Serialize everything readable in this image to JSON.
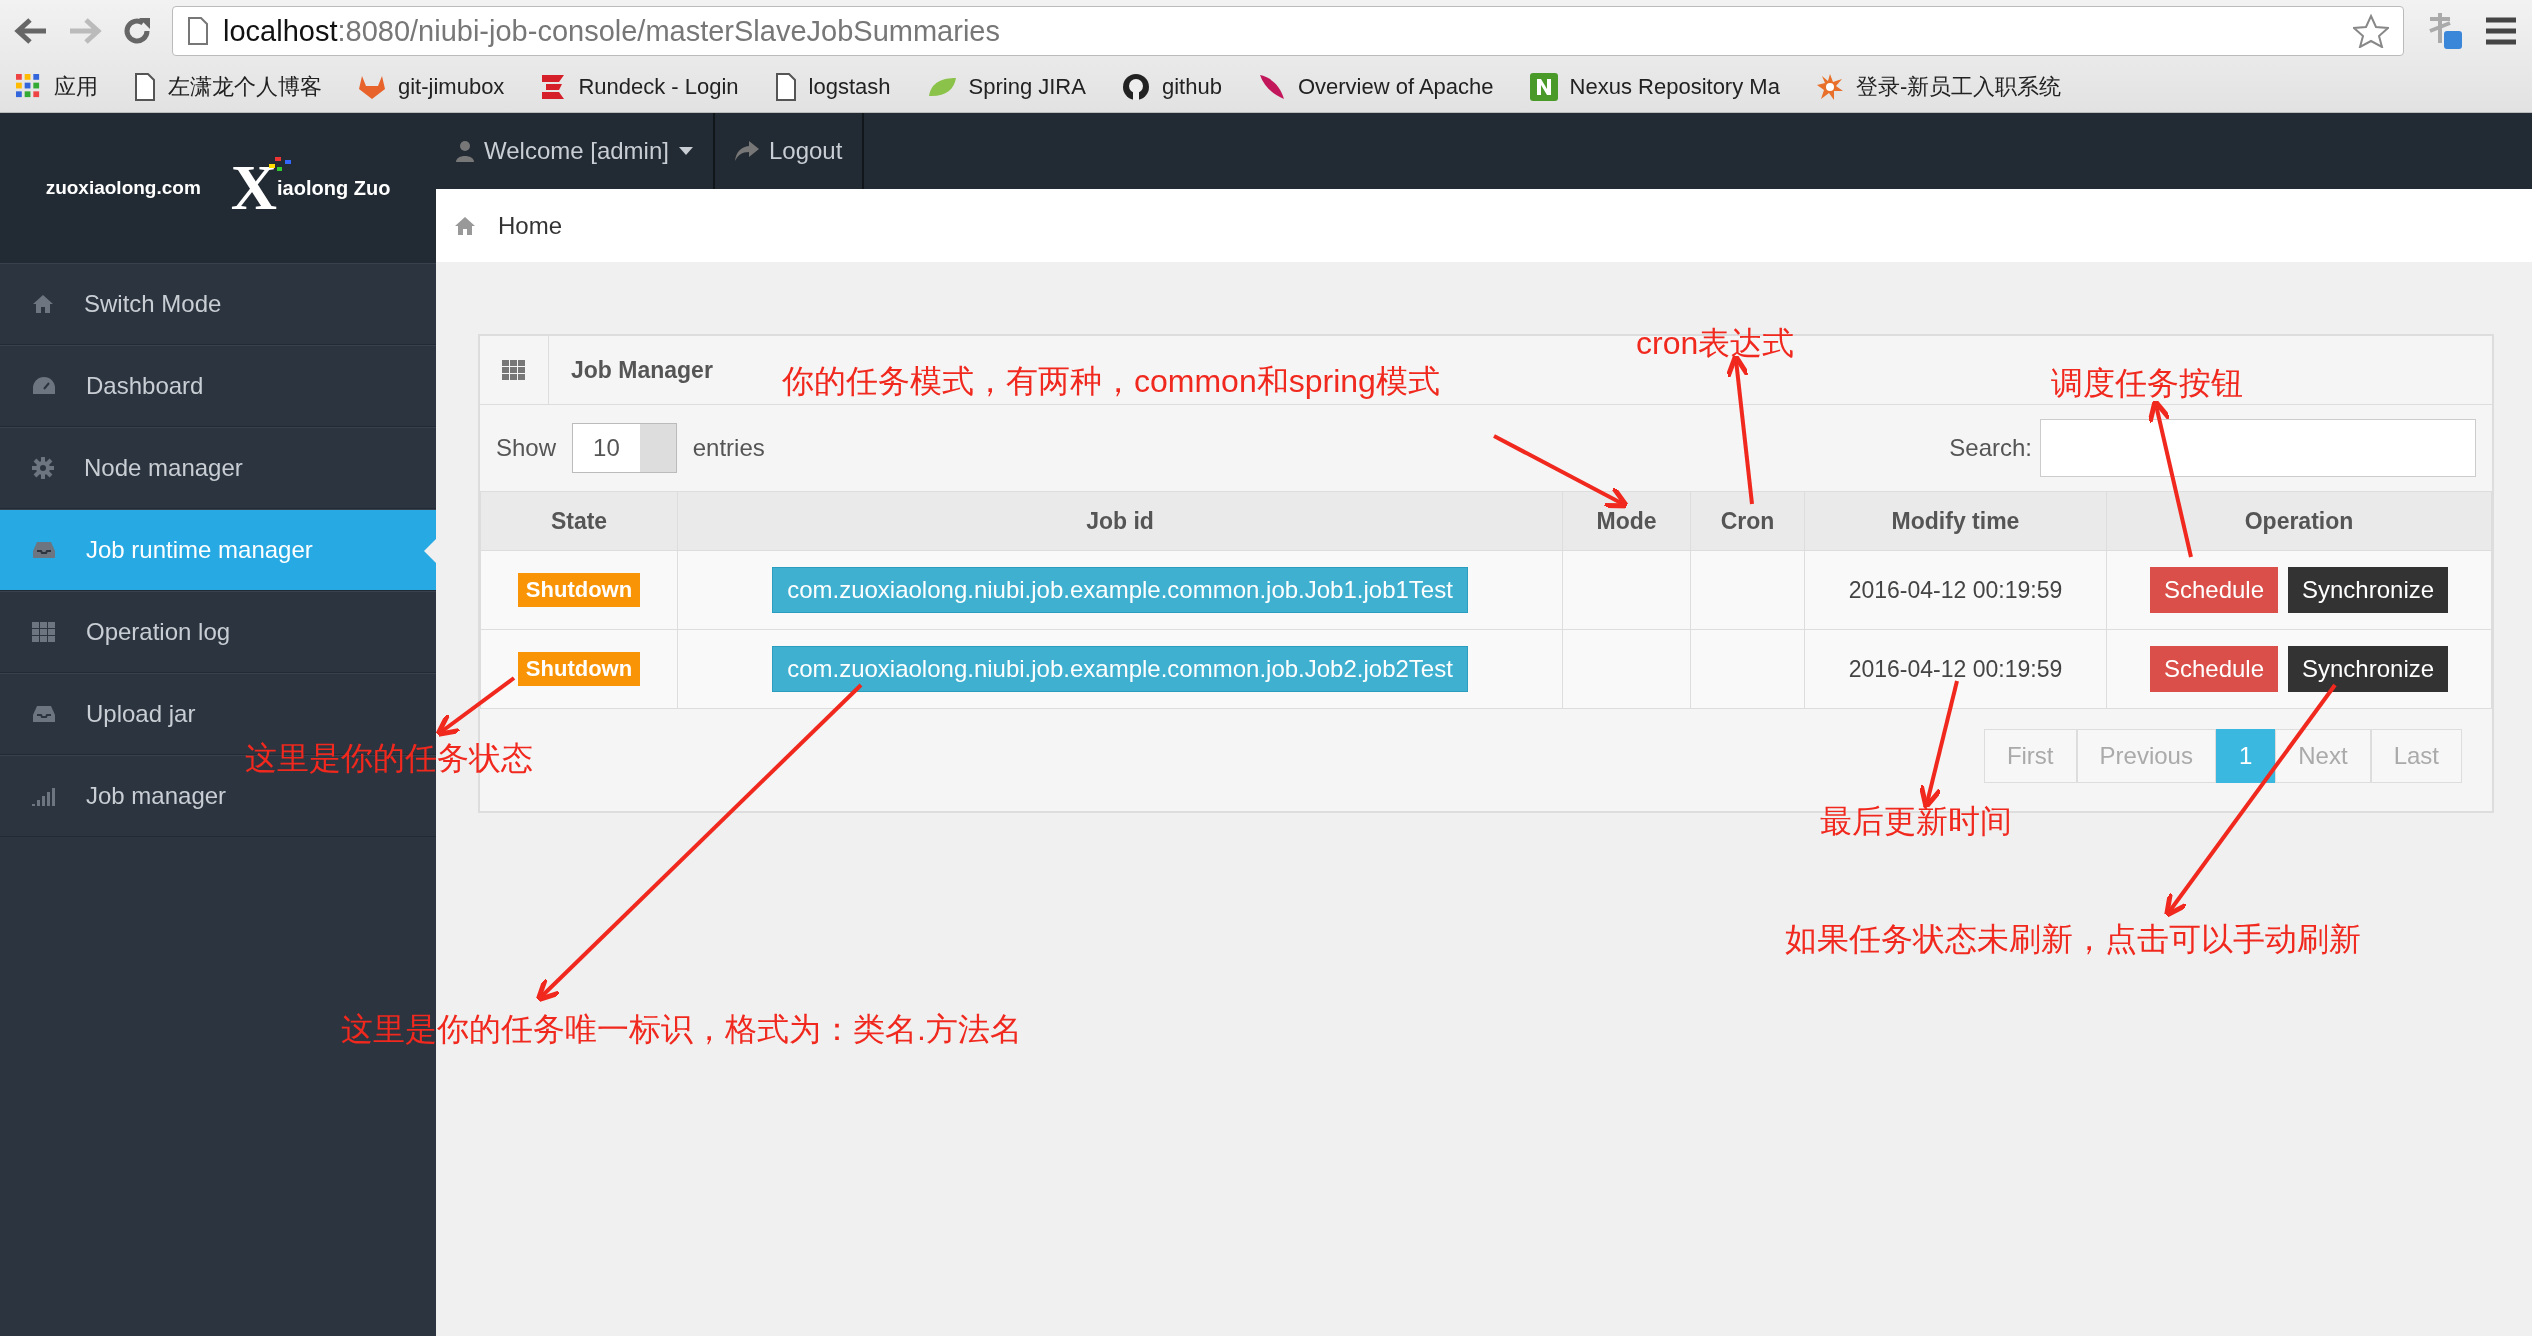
{
  "browser": {
    "url_host": "localhost",
    "url_rest": ":8080/niubi-job-console/masterSlaveJobSummaries",
    "bookmarks": [
      {
        "label": "应用",
        "kind": "apps"
      },
      {
        "label": "左潇龙个人博客",
        "kind": "page"
      },
      {
        "label": "git-jimubox",
        "kind": "fox"
      },
      {
        "label": "Rundeck - Login",
        "kind": "rundeck"
      },
      {
        "label": "logstash",
        "kind": "page"
      },
      {
        "label": "Spring JIRA",
        "kind": "leaf"
      },
      {
        "label": "github",
        "kind": "github"
      },
      {
        "label": "Overview of Apache",
        "kind": "feather"
      },
      {
        "label": "Nexus Repository Ma",
        "kind": "nexus"
      },
      {
        "label": "登录-新员工入职系统",
        "kind": "burst"
      }
    ]
  },
  "sidebar": {
    "logo_domain": "zuoxiaolong.com",
    "logo_mark": "X",
    "logo_name": "iaolong Zuo",
    "items": [
      {
        "label": "Switch Mode",
        "kind": "home",
        "selected": false
      },
      {
        "label": "Dashboard",
        "kind": "gauge",
        "selected": false
      },
      {
        "label": "Node manager",
        "kind": "gear",
        "selected": false
      },
      {
        "label": "Job runtime manager",
        "kind": "tray",
        "selected": true
      },
      {
        "label": "Operation log",
        "kind": "grid",
        "selected": false
      },
      {
        "label": "Upload jar",
        "kind": "tray",
        "selected": false
      },
      {
        "label": "Job manager",
        "kind": "bars",
        "selected": false
      }
    ]
  },
  "topbar": {
    "user_menu": "Welcome [admin]",
    "logout": "Logout"
  },
  "breadcrumb": "Home",
  "panel": {
    "title": "Job Manager",
    "show_label": "Show",
    "page_size": "10",
    "entries_label": "entries",
    "search_label": "Search:",
    "columns": [
      "State",
      "Job id",
      "Mode",
      "Cron",
      "Modify time",
      "Operation"
    ],
    "rows": [
      {
        "state": "Shutdown",
        "job_id": "com.zuoxiaolong.niubi.job.example.common.job.Job1.job1Test",
        "modify_time": "2016-04-12 00:19:59",
        "actions": [
          "Schedule",
          "Synchronize"
        ]
      },
      {
        "state": "Shutdown",
        "job_id": "com.zuoxiaolong.niubi.job.example.common.job.Job2.job2Test",
        "modify_time": "2016-04-12 00:19:59",
        "actions": [
          "Schedule",
          "Synchronize"
        ]
      }
    ],
    "pagination": [
      {
        "label": "First",
        "selected": false
      },
      {
        "label": "Previous",
        "selected": false
      },
      {
        "label": "1",
        "selected": true
      },
      {
        "label": "Next",
        "selected": false
      },
      {
        "label": "Last",
        "selected": false
      }
    ]
  },
  "annotations": [
    {
      "text": "你的任务模式，有两种，common和spring模式"
    },
    {
      "text": "cron表达式"
    },
    {
      "text": "调度任务按钮"
    },
    {
      "text": "这里是你的任务状态"
    },
    {
      "text": "最后更新时间"
    },
    {
      "text": "如果任务状态未刷新，点击可以手动刷新"
    },
    {
      "text": "这里是你的任务唯一标识，格式为：类名.方法名"
    }
  ]
}
